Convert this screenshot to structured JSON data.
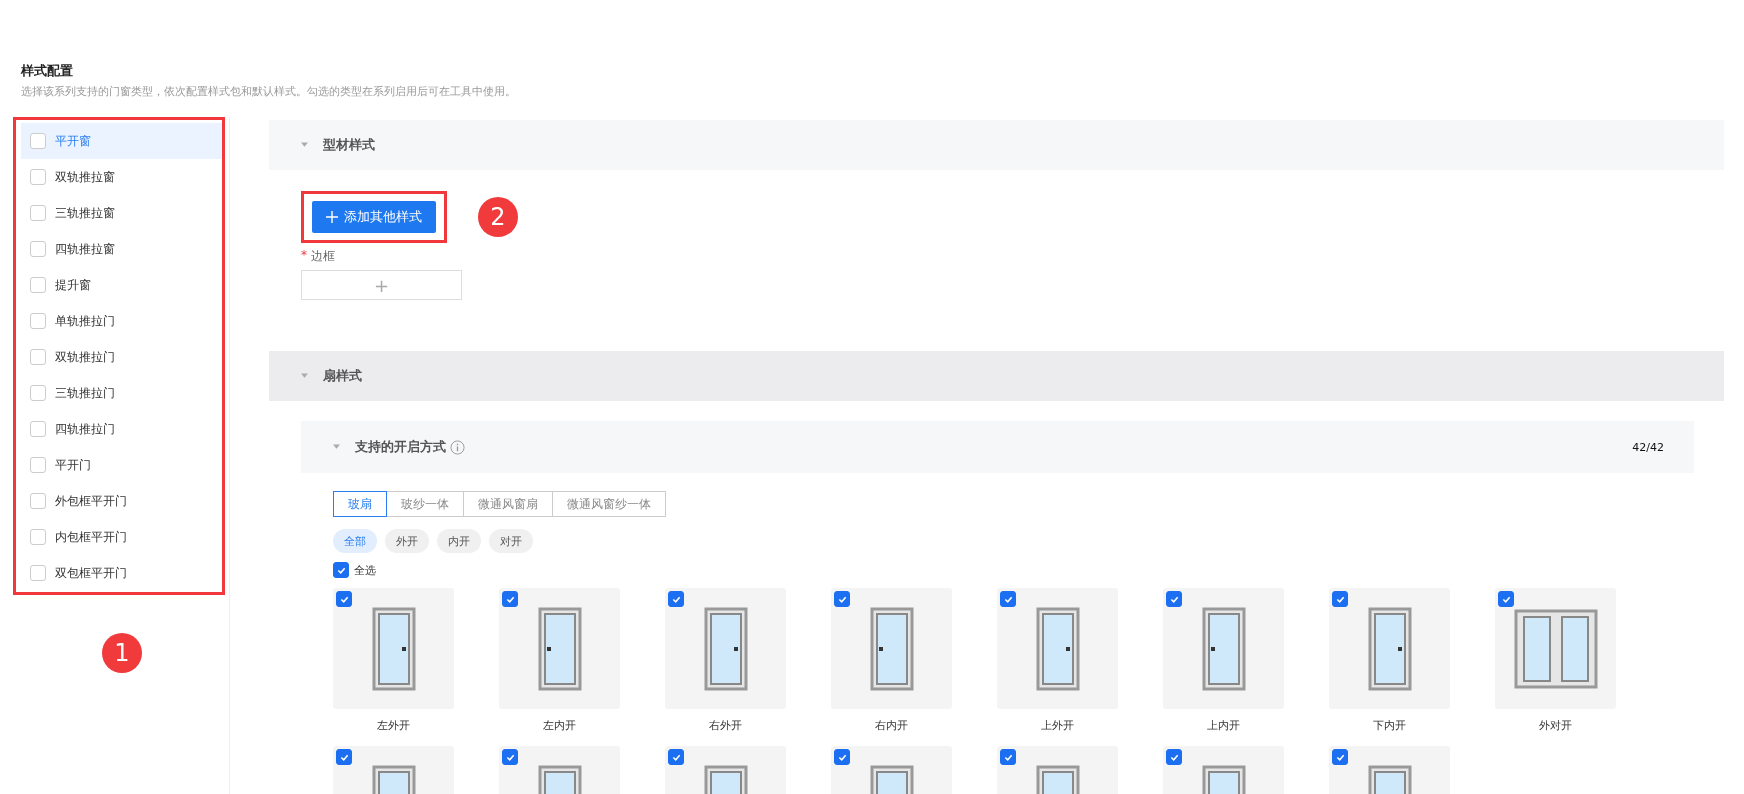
{
  "header": {
    "title": "样式配置",
    "description": "选择该系列支持的门窗类型，依次配置样式包和默认样式。勾选的类型在系列启用后可在工具中使用。"
  },
  "window_types": [
    {
      "label": "平开窗",
      "checked": false,
      "selected": true
    },
    {
      "label": "双轨推拉窗",
      "checked": false,
      "selected": false
    },
    {
      "label": "三轨推拉窗",
      "checked": false,
      "selected": false
    },
    {
      "label": "四轨推拉窗",
      "checked": false,
      "selected": false
    },
    {
      "label": "提升窗",
      "checked": false,
      "selected": false
    },
    {
      "label": "单轨推拉门",
      "checked": false,
      "selected": false
    },
    {
      "label": "双轨推拉门",
      "checked": false,
      "selected": false
    },
    {
      "label": "三轨推拉门",
      "checked": false,
      "selected": false
    },
    {
      "label": "四轨推拉门",
      "checked": false,
      "selected": false
    },
    {
      "label": "平开门",
      "checked": false,
      "selected": false
    },
    {
      "label": "外包框平开门",
      "checked": false,
      "selected": false
    },
    {
      "label": "内包框平开门",
      "checked": false,
      "selected": false
    },
    {
      "label": "双包框平开门",
      "checked": false,
      "selected": false
    }
  ],
  "profile_section": {
    "title": "型材样式",
    "add_button": "添加其他样式",
    "field_label": "边框",
    "required_mark": "*",
    "add_slot": "+"
  },
  "sash_section": {
    "title": "扇样式",
    "opening_panel": {
      "title": "支持的开启方式",
      "count": "42/42",
      "tabs": [
        {
          "label": "玻扇",
          "selected": true
        },
        {
          "label": "玻纱一体",
          "selected": false
        },
        {
          "label": "微通风窗扇",
          "selected": false
        },
        {
          "label": "微通风窗纱一体",
          "selected": false
        }
      ],
      "filters": [
        {
          "label": "全部",
          "selected": true
        },
        {
          "label": "外开",
          "selected": false
        },
        {
          "label": "内开",
          "selected": false
        },
        {
          "label": "对开",
          "selected": false
        }
      ],
      "select_all": {
        "label": "全选",
        "checked": true
      },
      "styles": [
        {
          "label": "左外开",
          "checked": true
        },
        {
          "label": "左内开",
          "checked": true
        },
        {
          "label": "右外开",
          "checked": true
        },
        {
          "label": "右内开",
          "checked": true
        },
        {
          "label": "上外开",
          "checked": true
        },
        {
          "label": "上内开",
          "checked": true
        },
        {
          "label": "下内开",
          "checked": true
        },
        {
          "label": "外对开",
          "checked": true
        },
        {
          "checked": true
        },
        {
          "checked": true
        },
        {
          "checked": true
        },
        {
          "checked": true
        },
        {
          "checked": true
        },
        {
          "checked": true
        },
        {
          "checked": true
        }
      ]
    }
  },
  "annotations": [
    {
      "number": "1"
    },
    {
      "number": "2"
    }
  ]
}
